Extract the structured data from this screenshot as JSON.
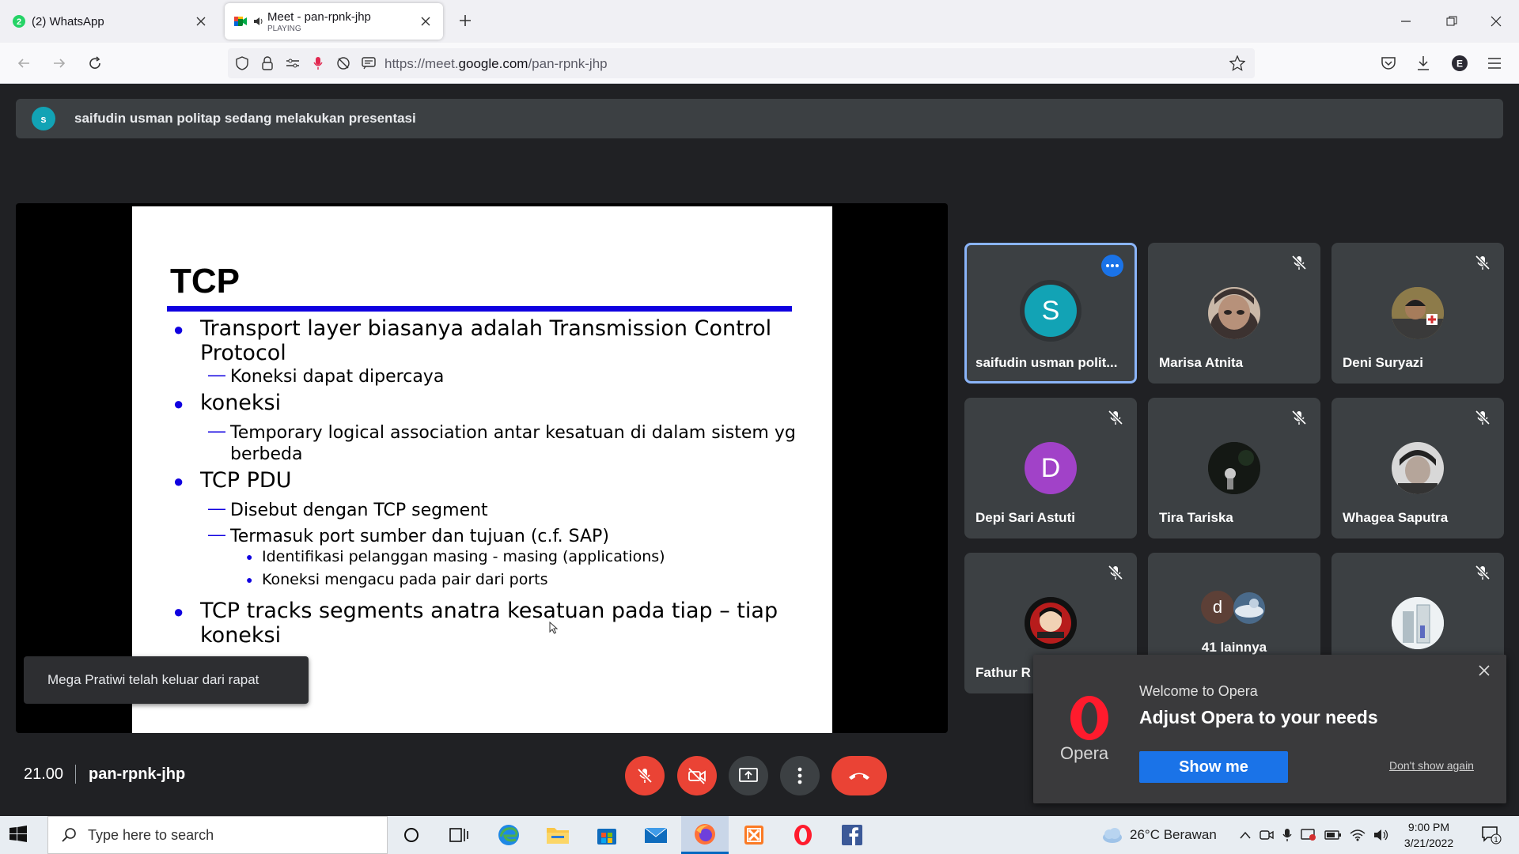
{
  "browser": {
    "tabs": [
      {
        "title": "(2) WhatsApp",
        "badge": "2"
      },
      {
        "title": "Meet - pan-rpnk-jhp",
        "subtitle": "PLAYING"
      }
    ],
    "url_prefix": "https://meet.",
    "url_domain": "google.com",
    "url_path": "/pan-rpnk-jhp",
    "profile_initial": "E"
  },
  "meet": {
    "presenter_initial": "s",
    "presenting_text": "saifudin usman politap sedang melakukan presentasi",
    "toast": "Mega Pratiwi telah keluar dari rapat",
    "participants": [
      {
        "name": "saifudin usman polit...",
        "initial": "S",
        "color": "#12a3b5",
        "speaking": true
      },
      {
        "name": "Marisa Atnita",
        "initial": "",
        "color": "#6b5a4e"
      },
      {
        "name": "Deni Suryazi",
        "initial": "",
        "color": "#8a7a50"
      },
      {
        "name": "Depi Sari Astuti",
        "initial": "D",
        "color": "#a142c8"
      },
      {
        "name": "Tira Tariska",
        "initial": "",
        "color": "#1c1c1c"
      },
      {
        "name": "Whagea Saputra",
        "initial": "",
        "color": "#444"
      },
      {
        "name": "Fathur R",
        "initial": "",
        "color": "#222"
      },
      {
        "name": "41 lainnya",
        "initial": "d",
        "color": "#5d4037"
      },
      {
        "name": "",
        "initial": "",
        "color": "#cfd8dc"
      }
    ],
    "time": "21.00",
    "meeting_code": "pan-rpnk-jhp"
  },
  "slide": {
    "title": "TCP",
    "lines": [
      "Transport layer biasanya adalah Transmission Control",
      "Protocol",
      "Koneksi dapat dipercaya",
      "koneksi",
      "Temporary logical association antar kesatuan di dalam sistem yg",
      "berbeda",
      "TCP PDU",
      "Disebut dengan TCP segment",
      "Termasuk port sumber dan tujuan (c.f. SAP)",
      "Identifikasi pelanggan masing - masing (applications)",
      "Koneksi mengacu pada pair dari ports",
      "TCP tracks segments anatra kesatuan pada tiap – tiap",
      "koneksi"
    ]
  },
  "opera": {
    "logo_text": "Opera",
    "welcome": "Welcome to Opera",
    "headline": "Adjust Opera to your needs",
    "button": "Show me",
    "dismiss": "Don't show again"
  },
  "taskbar": {
    "search_placeholder": "Type here to search",
    "weather": "26°C  Berawan",
    "time": "9:00 PM",
    "date": "3/21/2022",
    "notification_count": "1"
  },
  "colors": {
    "accent": "#1a73e8",
    "danger": "#ea4335",
    "slide_blue": "#1000e0"
  }
}
